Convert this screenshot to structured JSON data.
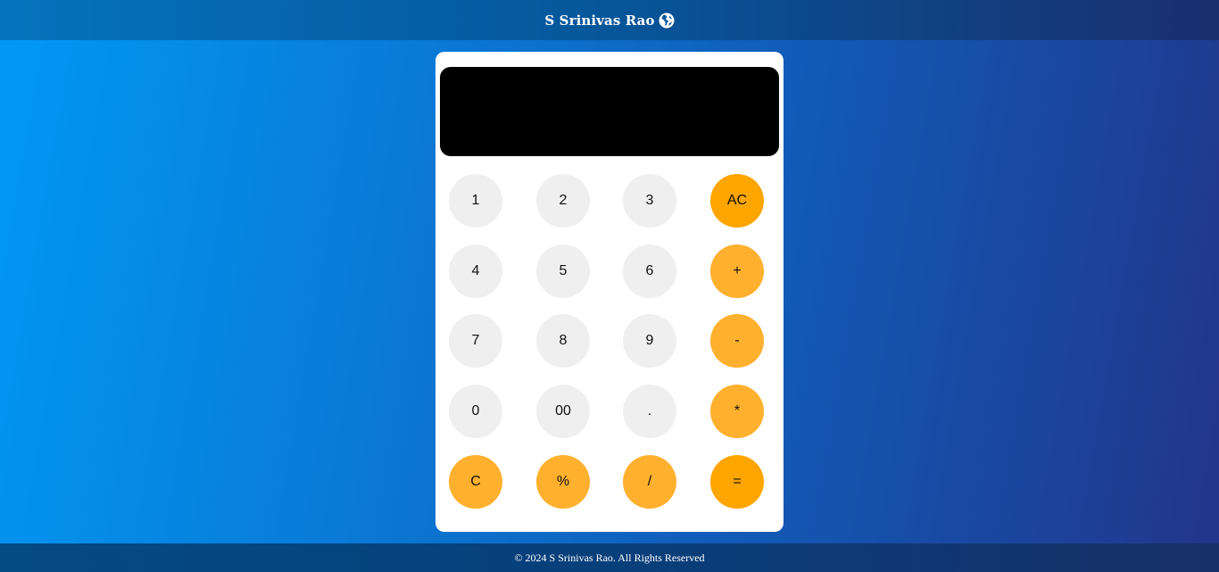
{
  "header": {
    "brand_name": "S Srinivas Rao",
    "brand_icon": "globe-icon"
  },
  "calculator": {
    "display_value": "",
    "keys": {
      "k1": "1",
      "k2": "2",
      "k3": "3",
      "ac": "AC",
      "k4": "4",
      "k5": "5",
      "k6": "6",
      "plus": "+",
      "k7": "7",
      "k8": "8",
      "k9": "9",
      "minus": "-",
      "k0": "0",
      "k00": "00",
      "dot": ".",
      "multiply": "*",
      "clear": "C",
      "percent": "%",
      "divide": "/",
      "equals": "="
    },
    "colors": {
      "number_key": "#efefef",
      "operator_key": "#ffb02e",
      "accent_key": "#ffa500",
      "display_bg": "#000000"
    }
  },
  "footer": {
    "copyright": "© 2024 S Srinivas Rao. All Rights Reserved"
  }
}
